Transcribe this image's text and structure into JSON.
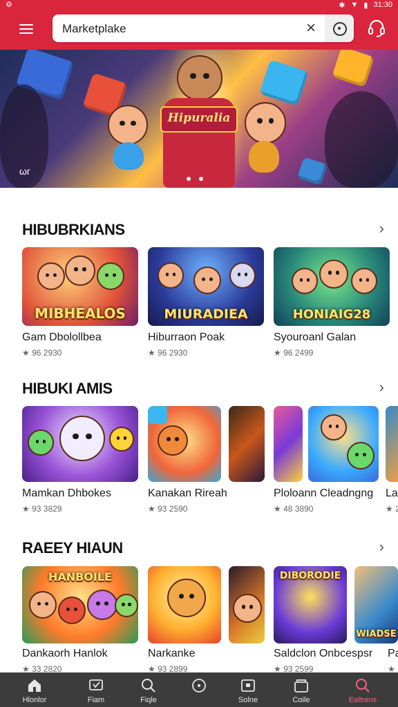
{
  "status": {
    "left": "⚙",
    "time": "31:30"
  },
  "search": {
    "value": "Marketplake",
    "clear": "×"
  },
  "banner": {
    "title": "Hipuralia",
    "corner": "ωг"
  },
  "sections": [
    {
      "title": "HIBUBRKIANS",
      "cards": [
        {
          "logo": "MIBHEALOS",
          "name": "Gam Dbolollbea",
          "meta": "★ 96 2930"
        },
        {
          "logo": "MIURADIEA",
          "name": "Hiburraon Poak",
          "meta": "★ 96 2930"
        },
        {
          "logo": "HONIAIG28",
          "name": "Syouroanl Galan",
          "meta": "★ 96 2499"
        }
      ]
    },
    {
      "title": "HIBUKI AMIS",
      "cards": [
        {
          "logo": "",
          "name": "Mamkan Dhbokes",
          "meta": "★ 93 3829"
        },
        {
          "logo": "",
          "name": "Kanakan Rireah",
          "meta": "★ 93 2590"
        },
        {
          "logo": "",
          "name": "Ploloann Cleadngng",
          "meta": "★ 48 3890"
        },
        {
          "logo": "",
          "name": "La",
          "meta": "★ 2"
        }
      ]
    },
    {
      "title": "RAEEY HIAUN",
      "cards": [
        {
          "logo": "HANBOILE",
          "name": "Dankaorh Hanlok",
          "meta": "★ 33 2820"
        },
        {
          "logo": "",
          "name": "Narkanke",
          "meta": "★ 93 2899"
        },
        {
          "logo": "DIBORODIE",
          "name": "Saldclon Onbcespsr",
          "meta": "★ 93 2599"
        },
        {
          "logo": "WIADSE",
          "name": "Pa",
          "meta": "★ 2"
        }
      ]
    }
  ],
  "nav": [
    {
      "label": "Hlonlor",
      "icon": "home-icon"
    },
    {
      "label": "Fiam",
      "icon": "heart-chat-icon"
    },
    {
      "label": "Fiqle",
      "icon": "search-icon"
    },
    {
      "label": "",
      "icon": "info-circle-icon"
    },
    {
      "label": "Solne",
      "icon": "dashboard-icon"
    },
    {
      "label": "Coile",
      "icon": "wallet-icon"
    },
    {
      "label": "Ealtrens",
      "icon": "search-icon"
    }
  ],
  "colors": {
    "brand": "#d9263d",
    "active_nav": "#ff5c8a",
    "nav_bg": "#3c3c3c"
  }
}
